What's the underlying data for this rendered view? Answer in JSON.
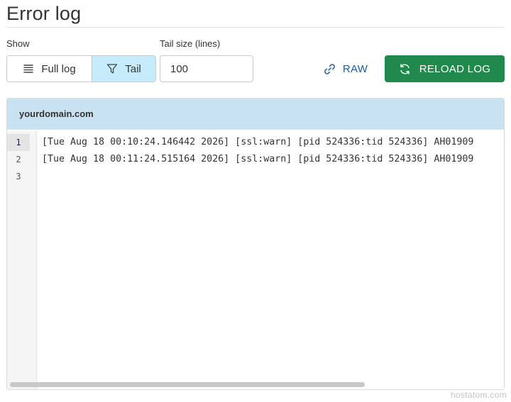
{
  "page": {
    "title": "Error log",
    "watermark": "hostatom.com"
  },
  "controls": {
    "show_label": "Show",
    "full_log_label": "Full log",
    "tail_label": "Tail",
    "selected_mode": "Tail",
    "tail_size_label": "Tail size (lines)",
    "tail_size_value": "100",
    "raw_label": "RAW",
    "reload_label": "RELOAD LOG"
  },
  "colors": {
    "selected_segment": "#c6ecfb",
    "reload_button": "#1f8a4c",
    "raw_link": "#1c5e94",
    "panel_header": "#c9e2f1"
  },
  "icons": {
    "full_log": "list-icon",
    "tail": "filter-icon",
    "raw": "link-icon",
    "reload": "refresh-icon"
  },
  "log_panel": {
    "domain": "yourdomain.com",
    "active_line": 1,
    "line_numbers": [
      "1",
      "2",
      "3"
    ],
    "lines": [
      "[Tue Aug 18 00:10:24.146442 2026] [ssl:warn] [pid 524336:tid 524336] AH01909",
      "[Tue Aug 18 00:11:24.515164 2026] [ssl:warn] [pid 524336:tid 524336] AH01909",
      ""
    ]
  }
}
